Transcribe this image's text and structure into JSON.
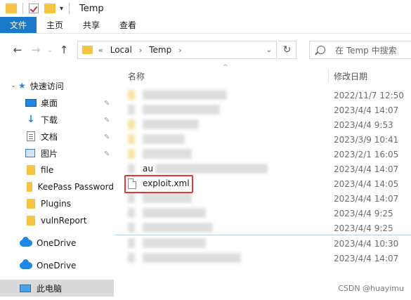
{
  "title": "Temp",
  "ribbon": {
    "tabs": [
      "文件",
      "主页",
      "共享",
      "查看"
    ]
  },
  "address": {
    "prefix": "«",
    "crumbs": [
      "Local",
      "Temp"
    ]
  },
  "search": {
    "placeholder": "在 Temp 中搜索"
  },
  "sidebar": {
    "quick_access": "快速访问",
    "items": [
      "桌面",
      "下载",
      "文档",
      "图片",
      "file",
      "KeePass Password",
      "Plugins",
      "vulnReport"
    ],
    "onedrive_1": "OneDrive",
    "onedrive_2": "OneDrive",
    "this_pc": "此电脑"
  },
  "columns": {
    "name": "名称",
    "date": "修改日期"
  },
  "files": [
    {
      "name": "",
      "date": "2022/11/7 12:50"
    },
    {
      "name": "",
      "date": "2023/4/4 14:07"
    },
    {
      "name": "",
      "date": "2023/4/4 9:53"
    },
    {
      "name": "",
      "date": "2023/3/9 10:41"
    },
    {
      "name": "",
      "date": "2023/2/1 16:05"
    },
    {
      "name": "au",
      "date": "2023/4/4 14:07"
    },
    {
      "name": "exploit.xml",
      "date": "2023/4/4 14:05"
    },
    {
      "name": "",
      "date": "2023/4/4 14:07"
    },
    {
      "name": "",
      "date": "2023/4/4 9:25"
    },
    {
      "name": "",
      "date": "2023/4/4 9:25"
    },
    {
      "name": "",
      "date": "2023/4/4 10:30"
    },
    {
      "name": "",
      "date": "2023/4/4 14:07"
    }
  ],
  "watermark": "CSDN @huayimu",
  "colors": {
    "file_tab": "#1979ca",
    "highlight_box": "#e53935",
    "folder": "#f6c344",
    "selected": "#d9d9d9"
  }
}
